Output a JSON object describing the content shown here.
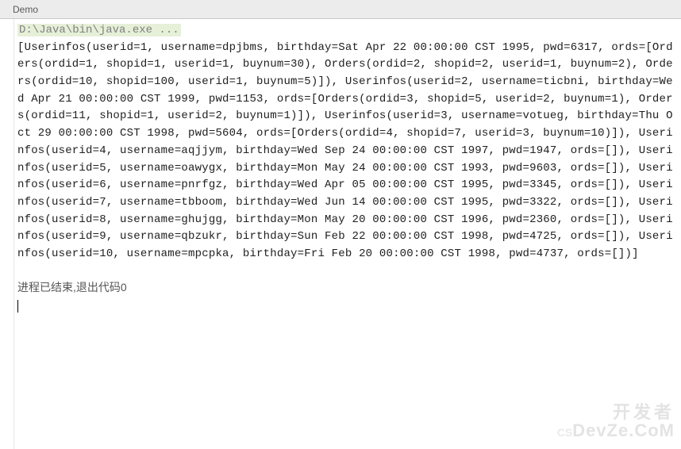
{
  "tab": {
    "label": "Demo"
  },
  "console": {
    "command": "D:\\Java\\bin\\java.exe ...",
    "output": "[Userinfos(userid=1, username=dpjbms, birthday=Sat Apr 22 00:00:00 CST 1995, pwd=6317, ords=[Orders(ordid=1, shopid=1, userid=1, buynum=30), Orders(ordid=2, shopid=2, userid=1, buynum=2), Orders(ordid=10, shopid=100, userid=1, buynum=5)]), Userinfos(userid=2, username=ticbni, birthday=Wed Apr 21 00:00:00 CST 1999, pwd=1153, ords=[Orders(ordid=3, shopid=5, userid=2, buynum=1), Orders(ordid=11, shopid=1, userid=2, buynum=1)]), Userinfos(userid=3, username=votueg, birthday=Thu Oct 29 00:00:00 CST 1998, pwd=5604, ords=[Orders(ordid=4, shopid=7, userid=3, buynum=10)]), Userinfos(userid=4, username=aqjjym, birthday=Wed Sep 24 00:00:00 CST 1997, pwd=1947, ords=[]), Userinfos(userid=5, username=oawygx, birthday=Mon May 24 00:00:00 CST 1993, pwd=9603, ords=[]), Userinfos(userid=6, username=pnrfgz, birthday=Wed Apr 05 00:00:00 CST 1995, pwd=3345, ords=[]), Userinfos(userid=7, username=tbboom, birthday=Wed Jun 14 00:00:00 CST 1995, pwd=3322, ords=[]), Userinfos(userid=8, username=ghujgg, birthday=Mon May 20 00:00:00 CST 1996, pwd=2360, ords=[]), Userinfos(userid=9, username=qbzukr, birthday=Sun Feb 22 00:00:00 CST 1998, pwd=4725, ords=[]), Userinfos(userid=10, username=mpcpka, birthday=Fri Feb 20 00:00:00 CST 1998, pwd=4737, ords=[])]",
    "exit_message": "进程已结束,退出代码0"
  },
  "watermark": {
    "line1": "开发者",
    "line2_prefix": "CS",
    "line2": "DevZe.CoM"
  }
}
